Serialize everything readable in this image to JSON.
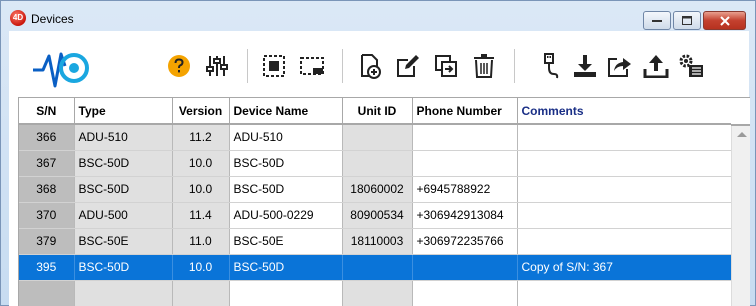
{
  "window": {
    "title": "Devices",
    "app_icon_text": "4D"
  },
  "toolbar": {
    "buttons": [
      {
        "name": "help",
        "icon": "question-circle-icon"
      },
      {
        "name": "settings",
        "icon": "sliders-icon"
      },
      {
        "name": "select-all",
        "icon": "select-all-icon"
      },
      {
        "name": "deselect",
        "icon": "deselect-icon"
      },
      {
        "name": "new-device",
        "icon": "new-document-icon"
      },
      {
        "name": "edit-device",
        "icon": "edit-icon"
      },
      {
        "name": "duplicate-device",
        "icon": "duplicate-icon"
      },
      {
        "name": "delete-device",
        "icon": "trash-icon"
      },
      {
        "name": "usb-connect",
        "icon": "usb-icon"
      },
      {
        "name": "download",
        "icon": "download-icon"
      },
      {
        "name": "share",
        "icon": "share-icon"
      },
      {
        "name": "upload",
        "icon": "upload-icon"
      },
      {
        "name": "batch-settings",
        "icon": "gears-list-icon"
      }
    ]
  },
  "table": {
    "headers": {
      "sn": "S/N",
      "type": "Type",
      "version": "Version",
      "device_name": "Device Name",
      "unit_id": "Unit ID",
      "phone": "Phone Number",
      "comments": "Comments"
    },
    "rows": [
      {
        "sn": "366",
        "type": "ADU-510",
        "version": "11.2",
        "device_name": "ADU-510",
        "unit_id": "",
        "phone": "",
        "comments": ""
      },
      {
        "sn": "367",
        "type": "BSC-50D",
        "version": "10.0",
        "device_name": "BSC-50D",
        "unit_id": "",
        "phone": "",
        "comments": ""
      },
      {
        "sn": "368",
        "type": "BSC-50D",
        "version": "10.0",
        "device_name": "BSC-50D",
        "unit_id": "18060002",
        "phone": "+6945788922",
        "comments": ""
      },
      {
        "sn": "370",
        "type": "ADU-500",
        "version": "11.4",
        "device_name": "ADU-500-0229",
        "unit_id": "80900534",
        "phone": "+306942913084",
        "comments": ""
      },
      {
        "sn": "379",
        "type": "BSC-50E",
        "version": "11.0",
        "device_name": "BSC-50E",
        "unit_id": "18110003",
        "phone": "+306972235766",
        "comments": ""
      },
      {
        "sn": "395",
        "type": "BSC-50D",
        "version": "10.0",
        "device_name": "BSC-50D",
        "unit_id": "",
        "phone": "",
        "comments": "Copy of S/N: 367",
        "selected": true
      },
      {
        "sn": "",
        "type": "",
        "version": "",
        "device_name": "",
        "unit_id": "",
        "phone": "",
        "comments": ""
      }
    ]
  },
  "colors": {
    "selection": "#0a74d8",
    "sn_column": "#bdbdbd",
    "grey_cells": "#e0e0e0",
    "help_icon": "#f4a300",
    "comments_header": "#1a2f86"
  }
}
